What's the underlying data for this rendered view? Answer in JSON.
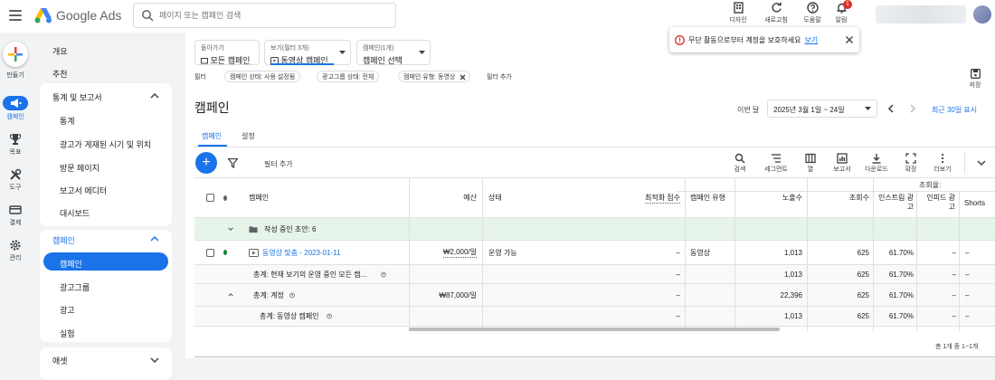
{
  "app": {
    "name": "Google Ads"
  },
  "search": {
    "placeholder": "페이지 또는 캠페인 검색"
  },
  "top_tools": [
    {
      "label": "디자인",
      "icon": "design-icon"
    },
    {
      "label": "새로고침",
      "icon": "refresh-icon"
    },
    {
      "label": "도움말",
      "icon": "help-icon"
    },
    {
      "label": "알림",
      "icon": "bell-icon",
      "badge": "1"
    }
  ],
  "rail": [
    {
      "label": "만들기",
      "icon": "plus-icon"
    },
    {
      "label": "캠페인",
      "icon": "megaphone-icon"
    },
    {
      "label": "목표",
      "icon": "trophy-icon"
    },
    {
      "label": "도구",
      "icon": "tools-icon"
    },
    {
      "label": "결제",
      "icon": "card-icon"
    },
    {
      "label": "관리",
      "icon": "gear-icon"
    }
  ],
  "nav": {
    "overview": "개요",
    "recommendations": "추천",
    "stats_header": "통계 및 보고서",
    "stats_items": [
      "통계",
      "광고가 게재된 시기 및 위치",
      "방문 페이지",
      "보고서 에디터",
      "대시보드"
    ],
    "campaigns_header": "캠페인",
    "campaign_items": [
      "캠페인",
      "광고그룹",
      "광고",
      "실험"
    ],
    "assets_header": "애셋"
  },
  "alert": {
    "text": "무단 활동으로부터 계정을 보호하세요",
    "link": "보기"
  },
  "chips": {
    "back": {
      "label": "돌아가기",
      "value": "모든 캠페인"
    },
    "view": {
      "label": "보기(필터 3개)",
      "value": "동영상 캠페인"
    },
    "campaign": {
      "label": "캠페인(1개)",
      "value": "캠페인 선택"
    }
  },
  "filters": {
    "label": "필터",
    "items": [
      "캠페인 상태: 사용 설정됨",
      "광고그룹 상태: 전체",
      "캠페인 유형: 동영상"
    ],
    "add": "필터 추가"
  },
  "save_label": "저장",
  "page_title": "캠페인",
  "date": {
    "label": "이번 달",
    "range": "2025년 3월 1일 ~ 24일",
    "recent": "최근 30일 표시"
  },
  "tabs": [
    "캠페인",
    "설정"
  ],
  "toolbar": {
    "add_filter": "필터 추가",
    "tools": [
      {
        "label": "검색",
        "icon": "search-icon"
      },
      {
        "label": "세그먼트",
        "icon": "segment-icon"
      },
      {
        "label": "열",
        "icon": "columns-icon"
      },
      {
        "label": "보고서",
        "icon": "report-icon"
      },
      {
        "label": "다운로드",
        "icon": "download-icon"
      },
      {
        "label": "확장",
        "icon": "expand-icon"
      },
      {
        "label": "더보기",
        "icon": "more-icon"
      }
    ]
  },
  "table": {
    "group_header": "조회율:",
    "headers": {
      "campaign": "캠페인",
      "budget": "예산",
      "status": "상태",
      "opt_score": "최적화 점수",
      "type": "캠페인 유형",
      "impressions": "노출수",
      "views": "조회수",
      "instream": "인스트림 광고",
      "infeed": "인피드 광고",
      "shorts": "Shorts"
    },
    "draft_row": "작성 중인 초안: 6",
    "campaign_row": {
      "name": "동영상 맞춤 - 2023-01-11",
      "budget": "₩2,000/일",
      "status": "운영 가능",
      "opt_score": "–",
      "type": "동영상",
      "impressions": "1,013",
      "views": "625",
      "instream": "61.70%",
      "infeed": "–",
      "shorts": "–"
    },
    "totals": [
      {
        "label": "총계: 현재 보기의 운영 중인 모든 캠...",
        "budget": "",
        "opt_score": "–",
        "impressions": "1,013",
        "views": "625",
        "instream": "61.70%",
        "infeed": "–",
        "shorts": "–"
      },
      {
        "label": "총계: 계정",
        "budget": "₩87,000/일",
        "opt_score": "–",
        "impressions": "22,396",
        "views": "625",
        "instream": "61.70%",
        "infeed": "–",
        "shorts": "–"
      },
      {
        "label": "총계: 동영상 캠페인",
        "budget": "",
        "opt_score": "–",
        "impressions": "1,013",
        "views": "625",
        "instream": "61.70%",
        "infeed": "–",
        "shorts": "–"
      }
    ],
    "pagination": "총 1개 중 1~1개"
  },
  "colors": {
    "accent": "#1a73e8",
    "enabled_dot": "#188038",
    "error": "#d93025",
    "draft_bg": "#e6f4ea"
  }
}
